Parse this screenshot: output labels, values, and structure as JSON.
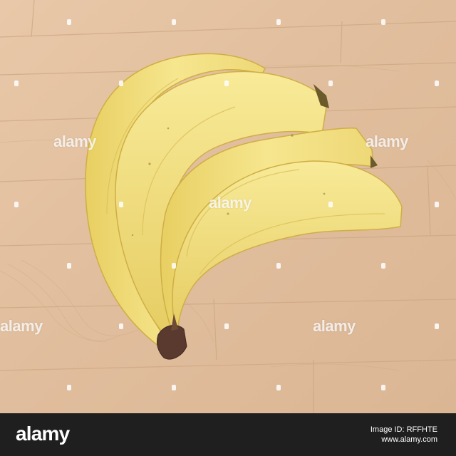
{
  "watermark": {
    "text": "alamy"
  },
  "footer": {
    "logo": "alamy",
    "image_id_label": "Image ID: RFFHTE",
    "url": "www.alamy.com"
  },
  "colors": {
    "wood": "#e0bf9f",
    "banana": "#f3e283",
    "footer_bg": "#1f1f1f"
  }
}
